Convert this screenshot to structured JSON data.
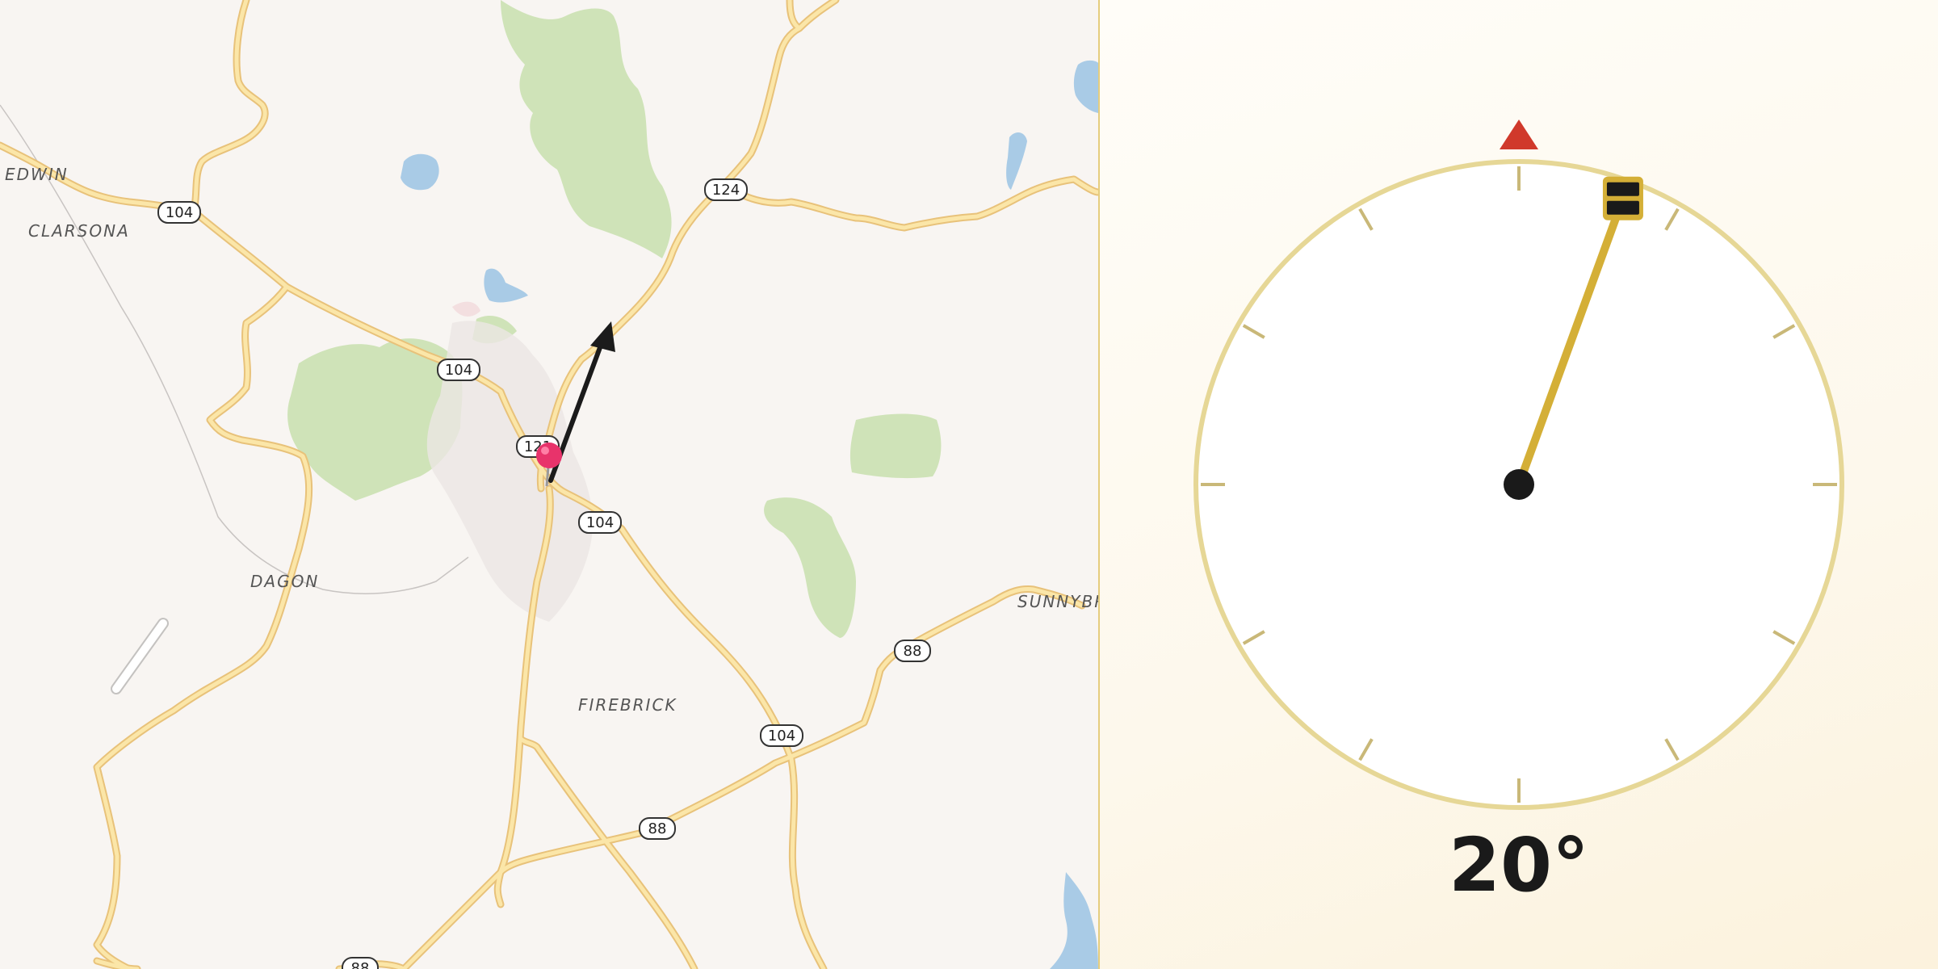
{
  "map": {
    "place_labels": {
      "edwin": "EDWIN",
      "clarsona": "CLARSONA",
      "dagon": "DAGON",
      "firebrick": "FIREBRICK",
      "sunnybrook": "SUNNYBRO"
    },
    "route_shields": {
      "r104_west": "104",
      "r104_center": "104",
      "r104_east": "104",
      "r104_south": "104",
      "r124_north": "124",
      "r124_center": "121",
      "r88_east": "88",
      "r88_south": "88",
      "r88_bottom": "88"
    },
    "colors": {
      "background": "#f8f5f2",
      "road": "#fbe6a8",
      "road_edge": "#e8c27a",
      "park": "#cfe3b8",
      "water": "#a9cbe6",
      "pin": "#e8336b"
    },
    "icons": {
      "location_pin": "map-pin-icon",
      "direction_arrow": "direction-arrow-icon"
    }
  },
  "compass": {
    "heading_deg": 20,
    "heading_text": "20°",
    "colors": {
      "needle": "#d4af37",
      "north_marker": "#d0392b",
      "ring": "#e6d796",
      "hub": "#1a1a1a"
    },
    "icons": {
      "north_marker": "north-triangle-icon",
      "needle_handle": "needle-handle-icon"
    }
  }
}
